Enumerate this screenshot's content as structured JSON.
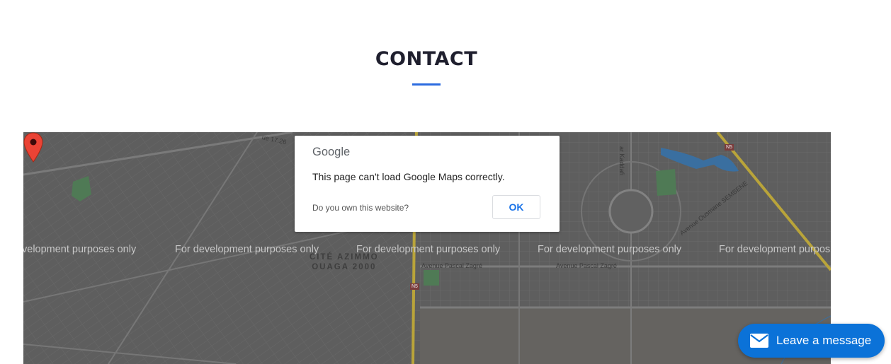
{
  "section": {
    "title": "CONTACT",
    "accent_color": "#2b6be0"
  },
  "map": {
    "watermark_text": "For development purposes only",
    "watermark_first": "velopment purposes only",
    "watermark_last": "For development purpos",
    "district_line1": "CITÉ AZIMMO",
    "district_line2": "OUAGA 2000",
    "street_labels": [
      "Avenue Pascal Zagré",
      "Avenue Pascal Zagré",
      "Avenue Ousmane SEMBENE",
      "ar Kaddafi",
      "ue 17.26"
    ],
    "route_shields": [
      "N5",
      "N5"
    ],
    "marker_icon": "map-pin-icon"
  },
  "dialog": {
    "brand": "Google",
    "message": "This page can't load Google Maps correctly.",
    "link_text": "Do you own this website?",
    "ok_label": "OK"
  },
  "chat": {
    "label": "Leave a message",
    "icon": "envelope-icon",
    "color": "#0b72d8"
  }
}
